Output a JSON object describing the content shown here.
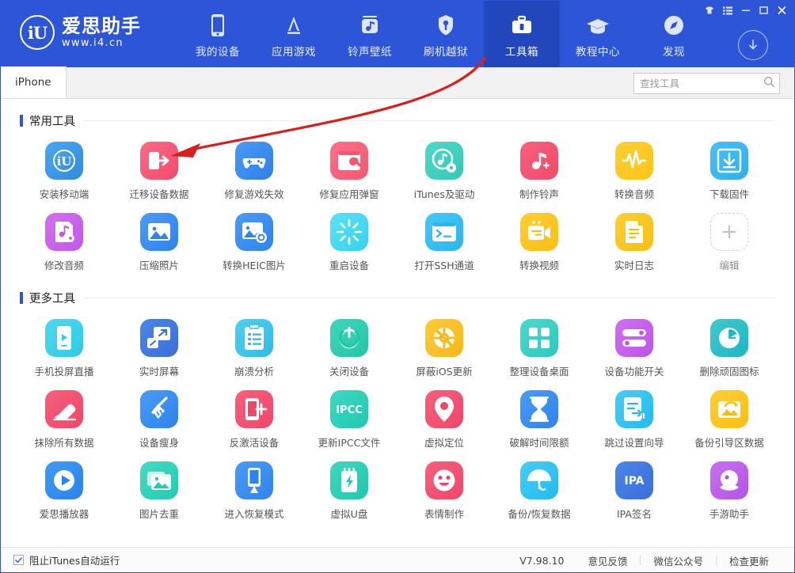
{
  "window": {
    "controls": [
      {
        "name": "skin-button",
        "glyph": "skin"
      },
      {
        "name": "menu-button",
        "glyph": "menu"
      },
      {
        "name": "minimize-button",
        "glyph": "minimize"
      },
      {
        "name": "maximize-button",
        "glyph": "maximize"
      },
      {
        "name": "close-button",
        "glyph": "close"
      }
    ]
  },
  "header": {
    "logo_mark": "iU",
    "brand_title": "爱思助手",
    "brand_url": "www.i4.cn",
    "accent": "#2c55d8",
    "nav": [
      {
        "label": "我的设备",
        "icon": "phone-icon",
        "active": false
      },
      {
        "label": "应用游戏",
        "icon": "appstore-icon",
        "active": false
      },
      {
        "label": "铃声壁纸",
        "icon": "music-box-icon",
        "active": false
      },
      {
        "label": "刷机越狱",
        "icon": "shield-icon",
        "active": false
      },
      {
        "label": "工具箱",
        "icon": "toolbox-icon",
        "active": true
      },
      {
        "label": "教程中心",
        "icon": "graduation-cap-icon",
        "active": false
      },
      {
        "label": "发现",
        "icon": "compass-icon",
        "active": false
      }
    ],
    "download_icon": "download-circle-icon"
  },
  "tabbar": {
    "tabs": [
      {
        "label": "iPhone",
        "active": true
      }
    ],
    "search": {
      "placeholder": "查找工具",
      "value": "",
      "icon": "search-icon"
    }
  },
  "sections": [
    {
      "title": "常用工具",
      "tools": [
        {
          "label": "安装移动端",
          "icon": "iu-app-icon",
          "bg": "linear-gradient(135deg,#4aa8f0,#2f8be0)"
        },
        {
          "label": "迁移设备数据",
          "icon": "migrate-icon",
          "bg": "linear-gradient(135deg,#fb6b86,#f24a6b)"
        },
        {
          "label": "修复游戏失效",
          "icon": "gamepad-icon",
          "bg": "linear-gradient(135deg,#4a9bf5,#2f7fe8)"
        },
        {
          "label": "修复应用弹窗",
          "icon": "window-wrench-icon",
          "bg": "linear-gradient(135deg,#fb7089,#f4576f)"
        },
        {
          "label": "iTunes及驱动",
          "icon": "itunes-gear-icon",
          "bg": "linear-gradient(135deg,#4fd9c8,#35c9b6)"
        },
        {
          "label": "制作铃声",
          "icon": "note-plus-icon",
          "bg": "linear-gradient(135deg,#f8607f,#ee4b69)"
        },
        {
          "label": "转换音频",
          "icon": "waveform-icon",
          "bg": "linear-gradient(135deg,#fdd033,#fbc315)"
        },
        {
          "label": "下载固件",
          "icon": "download-box-icon",
          "bg": "linear-gradient(135deg,#46c0f5,#2fb0ec)"
        },
        {
          "label": "修改音频",
          "icon": "audio-edit-icon",
          "bg": "linear-gradient(135deg,#d46ef0,#c05ae6)"
        },
        {
          "label": "压缩照片",
          "icon": "photo-icon",
          "bg": "linear-gradient(135deg,#4a9bf5,#2f84ec)"
        },
        {
          "label": "转换HEIC图片",
          "icon": "photo-convert-icon",
          "bg": "linear-gradient(135deg,#4a9bf5,#2f84ec)"
        },
        {
          "label": "重启设备",
          "icon": "restart-icon",
          "bg": "linear-gradient(135deg,#5ce1f5,#34d2ef)"
        },
        {
          "label": "打开SSH通道",
          "icon": "terminal-icon",
          "bg": "linear-gradient(135deg,#45c8f7,#2bb6ef)"
        },
        {
          "label": "转换视频",
          "icon": "video-convert-icon",
          "bg": "linear-gradient(135deg,#fdcf34,#f9be12)"
        },
        {
          "label": "实时日志",
          "icon": "log-file-icon",
          "bg": "linear-gradient(135deg,#fdcf34,#f9be12)"
        },
        {
          "label": "编辑",
          "icon": "plus-icon",
          "bg": "dashed"
        }
      ]
    },
    {
      "title": "更多工具",
      "tools": [
        {
          "label": "手机投屏直播",
          "icon": "screen-cast-icon",
          "bg": "linear-gradient(135deg,#4fd9ef,#2ecbe6)"
        },
        {
          "label": "实时屏幕",
          "icon": "screen-mirror-icon",
          "bg": "linear-gradient(135deg,#4a86e8,#3a6fd8)"
        },
        {
          "label": "崩溃分析",
          "icon": "clipboard-icon",
          "bg": "linear-gradient(135deg,#4fd0f0,#2fbce4)"
        },
        {
          "label": "关闭设备",
          "icon": "power-icon",
          "bg": "linear-gradient(135deg,#3fd6bb,#23c6a8)"
        },
        {
          "label": "屏蔽iOS更新",
          "icon": "block-update-icon",
          "bg": "linear-gradient(135deg,#fdcb3a,#f7b81a)"
        },
        {
          "label": "整理设备桌面",
          "icon": "grid-icon",
          "bg": "linear-gradient(135deg,#4ad9cd,#2dc9bc)"
        },
        {
          "label": "设备功能开关",
          "icon": "toggles-icon",
          "bg": "linear-gradient(135deg,#d06ef2,#bd55e8)"
        },
        {
          "label": "删除顽固图标",
          "icon": "clock-icon",
          "bg": "linear-gradient(135deg,#3fc9cf,#1fb7c2)"
        },
        {
          "label": "抹除所有数据",
          "icon": "eraser-icon",
          "bg": "linear-gradient(135deg,#f85f7e,#ef4768)"
        },
        {
          "label": "设备瘦身",
          "icon": "broom-icon",
          "bg": "linear-gradient(135deg,#4a9bf5,#2f84ec)"
        },
        {
          "label": "反激活设备",
          "icon": "deactivate-icon",
          "bg": "linear-gradient(135deg,#f85f7e,#ef4768)"
        },
        {
          "label": "更新IPCC文件",
          "icon": "ipcc-icon",
          "bg": "linear-gradient(135deg,#3fd8c2,#20c9b1)"
        },
        {
          "label": "虚拟定位",
          "icon": "location-pin-icon",
          "bg": "linear-gradient(135deg,#f85f7e,#ef4768)"
        },
        {
          "label": "破解时间限额",
          "icon": "hourglass-icon",
          "bg": "linear-gradient(135deg,#4a9bf5,#2f84ec)"
        },
        {
          "label": "跳过设置向导",
          "icon": "skip-setup-icon",
          "bg": "linear-gradient(135deg,#45cdf7,#24bbef)"
        },
        {
          "label": "备份引导区数据",
          "icon": "backup-boot-icon",
          "bg": "linear-gradient(135deg,#fdcf34,#f9be12)"
        },
        {
          "label": "爱思播放器",
          "icon": "play-icon",
          "bg": "linear-gradient(135deg,#3f9cf5,#2a83e8)"
        },
        {
          "label": "图片去重",
          "icon": "photo-stack-icon",
          "bg": "linear-gradient(135deg,#44dcc2,#23cbaf)"
        },
        {
          "label": "进入恢复模式",
          "icon": "recovery-icon",
          "bg": "linear-gradient(135deg,#4a9bf5,#2f84ec)"
        },
        {
          "label": "虚拟U盘",
          "icon": "usb-drive-icon",
          "bg": "linear-gradient(135deg,#3fd8bf,#1fc8ae)"
        },
        {
          "label": "表情制作",
          "icon": "emoji-icon",
          "bg": "linear-gradient(135deg,#f85f7e,#ef4768)"
        },
        {
          "label": "备份/恢复数据",
          "icon": "umbrella-icon",
          "bg": "linear-gradient(135deg,#45cdf7,#24bbef)"
        },
        {
          "label": "IPA签名",
          "icon": "ipa-icon",
          "bg": "linear-gradient(135deg,#4a86e8,#3a6fd8)"
        },
        {
          "label": "手游助手",
          "icon": "game-assistant-icon",
          "bg": "linear-gradient(135deg,#c96ef0,#b455e6)"
        }
      ]
    }
  ],
  "footer": {
    "checkbox": {
      "label": "阻止iTunes自动运行",
      "checked": true
    },
    "version": "V7.98.10",
    "links": [
      "意见反馈",
      "微信公众号",
      "检查更新"
    ]
  },
  "annotation": {
    "type": "red-arrow",
    "from": "toolbox-nav-item",
    "to": "migrate-device-data-tool",
    "color": "#d81f1f"
  }
}
